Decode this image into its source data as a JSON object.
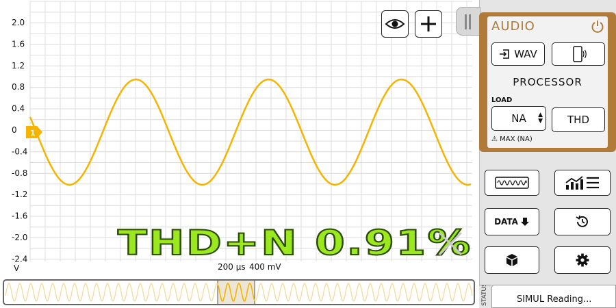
{
  "scope": {
    "y_unit": "V",
    "y_ticks": [
      "2.0",
      "1.6",
      "1.2",
      "0.8",
      "0.4",
      "0",
      "-0.4",
      "-0.8",
      "-1.2",
      "-1.6",
      "-2.0",
      "-2.4"
    ],
    "timebase": "200 µs",
    "volts_per_div": "400 mV",
    "channel_marker": "1",
    "trace_color": "#f5b400",
    "grid_color": "#dcdcdc"
  },
  "thd_readout": "THD+N 0.91%",
  "icons": {
    "eye": "eye-icon",
    "plus": "plus-icon",
    "close": "close-icon",
    "power": "power-icon"
  },
  "audio_panel": {
    "title": "AUDIO",
    "wav_label": "WAV",
    "processor_label": "PROCESSOR",
    "load_label": "LOAD",
    "load_value": "NA",
    "thd_label": "THD",
    "max_label": "MAX (NA)",
    "accent_color": "#b07a38"
  },
  "tools": {
    "data_label": "DATA"
  },
  "status": {
    "tab_label": "STATUS",
    "text": "SIMUL Reading..."
  }
}
